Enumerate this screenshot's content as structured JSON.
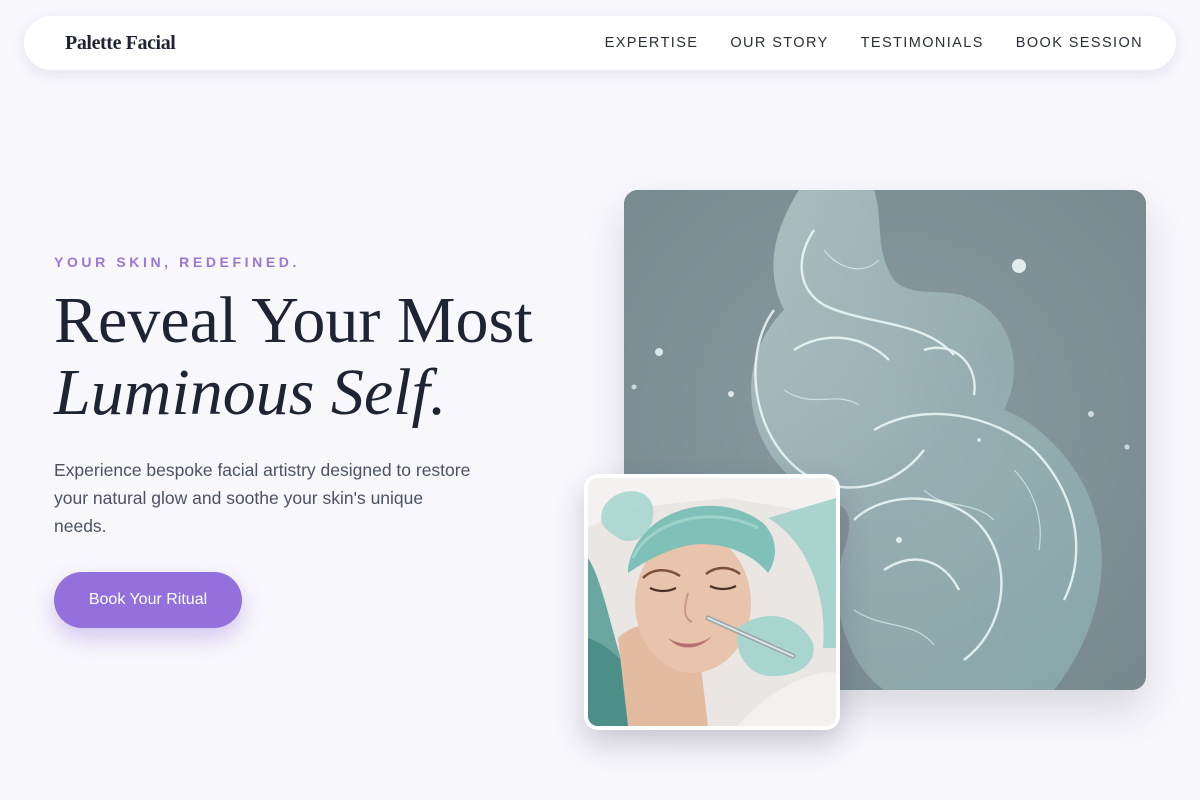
{
  "nav": {
    "brand": "Palette Facial",
    "links": [
      "EXPERTISE",
      "OUR STORY",
      "TESTIMONIALS",
      "BOOK SESSION"
    ]
  },
  "hero": {
    "eyebrow": "YOUR SKIN, REDEFINED.",
    "headline_line1": "Reveal Your Most",
    "headline_line2": "Luminous Self.",
    "description": "Experience bespoke facial artistry designed to restore your natural glow and soothe your skin's unique needs.",
    "cta_label": "Book Your Ritual"
  },
  "colors": {
    "accent": "#9370db",
    "eyebrow": "#9b76d3",
    "background": "#f8f7fc",
    "heading": "#1e2433"
  },
  "images": {
    "main": "water-splash-image",
    "secondary": "facial-treatment-photo"
  }
}
